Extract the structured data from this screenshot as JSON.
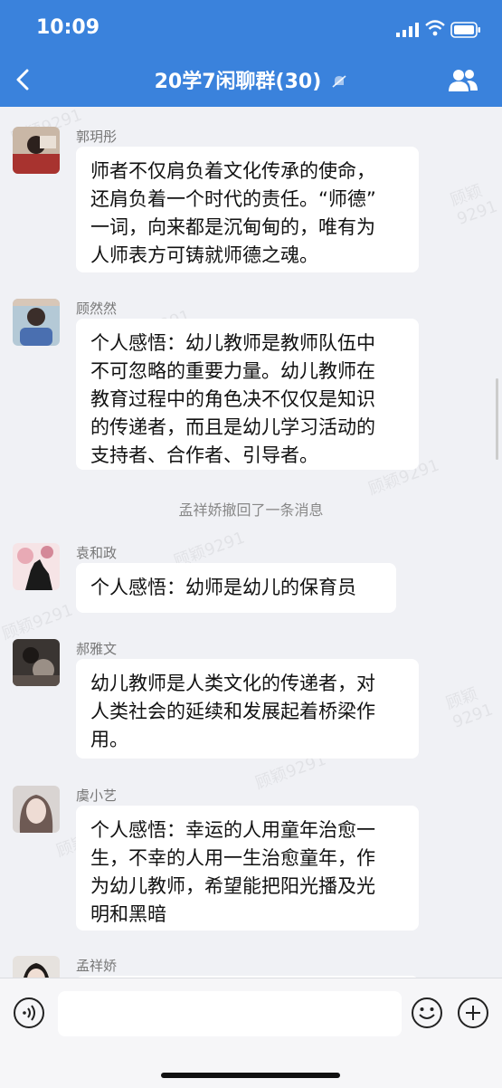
{
  "status": {
    "time": "10:09"
  },
  "header": {
    "title": "20学7闲聊群(30)",
    "accent": "#3a82dc"
  },
  "messages": [
    {
      "sender": "郭玥彤",
      "text": "师者不仅肩负着文化传承的使命，\n还肩负着一个时代的责任。“师德”\n一词，向来都是沉甸甸的，唯有为\n人师表方可铸就师德之魂。"
    },
    {
      "sender": "顾然然",
      "text": "个人感悟：幼儿教师是教师队伍中\n不可忽略的重要力量。幼儿教师在\n教育过程中的角色决不仅仅是知识\n的传递者，而且是幼儿学习活动的\n支持者、合作者、引导者。"
    },
    {
      "sender": "袁和政",
      "text": "个人感悟：幼师是幼儿的保育员"
    },
    {
      "sender": "郝雅文",
      "text": "幼儿教师是人类文化的传递者，对\n人类社会的延续和发展起着桥梁作\n用。"
    },
    {
      "sender": "虞小艺",
      "text": "个人感悟：幸运的人用童年治愈一\n生，不幸的人用一生治愈童年，作\n为幼儿教师，希望能把阳光播及光\n明和黑暗"
    },
    {
      "sender": "孟祥娇",
      "text": ""
    }
  ],
  "recall_notice": "孟祥娇撤回了一条消息",
  "watermark": "顾颖9291",
  "icons": {
    "back": "chevron-left-icon",
    "mute": "bell-off-icon",
    "members": "group-icon",
    "voice": "voice-icon",
    "emoji": "smiley-icon",
    "plus": "plus-icon"
  }
}
